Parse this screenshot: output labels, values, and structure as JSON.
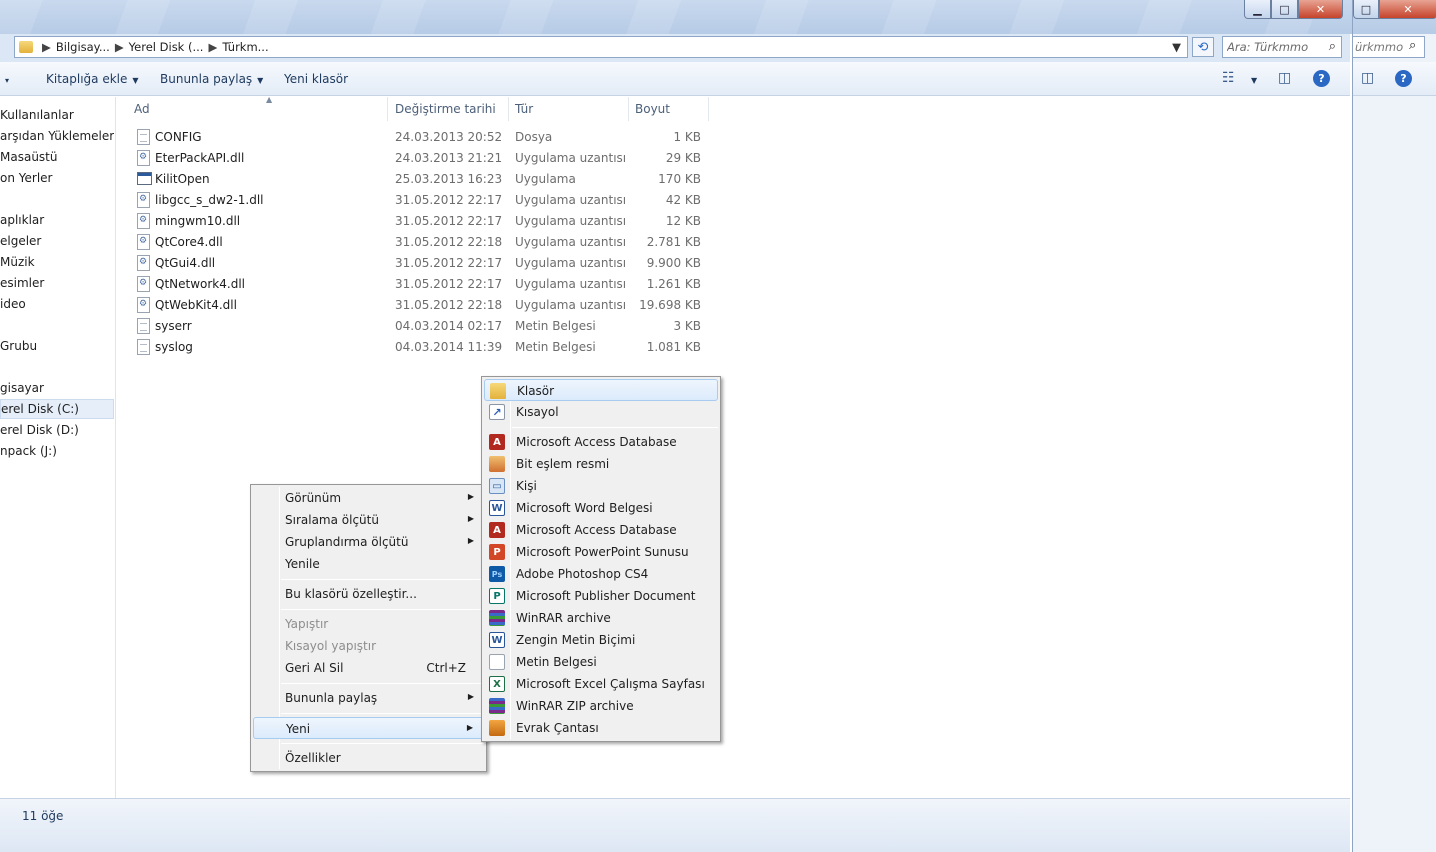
{
  "address": {
    "crumbs": [
      "Bilgisay...",
      "Yerel Disk (...",
      "Türkm..."
    ],
    "search_placeholder": "Ara: Türkmmo",
    "sliver_search": "ürkmmo"
  },
  "toolbar": {
    "organize_arrow": "▾",
    "add_library": "Kitaplığa ekle",
    "share_with": "Bununla paylaş",
    "new_folder": "Yeni klasör"
  },
  "nav": {
    "items": [
      "Kullanılanlar",
      "arşıdan Yüklemeler",
      "Masaüstü",
      "on Yerler",
      "aplıklar",
      "elgeler",
      "Müzik",
      "esimler",
      "ideo",
      "Grubu",
      "gisayar",
      "erel Disk (C:)",
      "erel Disk (D:)",
      "npack (J:)"
    ]
  },
  "columns": [
    "Ad",
    "Değiştirme tarihi",
    "Tür",
    "Boyut"
  ],
  "files": [
    {
      "name": "CONFIG",
      "date": "24.03.2013 20:52",
      "type": "Dosya",
      "size": "1 KB",
      "icon": "txt"
    },
    {
      "name": "EterPackAPI.dll",
      "date": "24.03.2013 21:21",
      "type": "Uygulama uzantısı",
      "size": "29 KB",
      "icon": "dll"
    },
    {
      "name": "KilitOpen",
      "date": "25.03.2013 16:23",
      "type": "Uygulama",
      "size": "170 KB",
      "icon": "exe"
    },
    {
      "name": "libgcc_s_dw2-1.dll",
      "date": "31.05.2012 22:17",
      "type": "Uygulama uzantısı",
      "size": "42 KB",
      "icon": "dll"
    },
    {
      "name": "mingwm10.dll",
      "date": "31.05.2012 22:17",
      "type": "Uygulama uzantısı",
      "size": "12 KB",
      "icon": "dll"
    },
    {
      "name": "QtCore4.dll",
      "date": "31.05.2012 22:18",
      "type": "Uygulama uzantısı",
      "size": "2.781 KB",
      "icon": "dll"
    },
    {
      "name": "QtGui4.dll",
      "date": "31.05.2012 22:17",
      "type": "Uygulama uzantısı",
      "size": "9.900 KB",
      "icon": "dll"
    },
    {
      "name": "QtNetwork4.dll",
      "date": "31.05.2012 22:17",
      "type": "Uygulama uzantısı",
      "size": "1.261 KB",
      "icon": "dll"
    },
    {
      "name": "QtWebKit4.dll",
      "date": "31.05.2012 22:18",
      "type": "Uygulama uzantısı",
      "size": "19.698 KB",
      "icon": "dll"
    },
    {
      "name": "syserr",
      "date": "04.03.2014 02:17",
      "type": "Metin Belgesi",
      "size": "3 KB",
      "icon": "txt"
    },
    {
      "name": "syslog",
      "date": "04.03.2014 11:39",
      "type": "Metin Belgesi",
      "size": "1.081 KB",
      "icon": "txt"
    }
  ],
  "context_menu": {
    "view": "Görünüm",
    "sort_by": "Sıralama ölçütü",
    "group_by": "Gruplandırma ölçütü",
    "refresh": "Yenile",
    "customize": "Bu klasörü özelleştir...",
    "paste": "Yapıştır",
    "paste_shortcut": "Kısayol yapıştır",
    "undo": "Geri Al Sil",
    "undo_shortcut": "Ctrl+Z",
    "share_with": "Bununla paylaş",
    "new": "Yeni",
    "properties": "Özellikler"
  },
  "new_menu": {
    "folder": "Klasör",
    "shortcut": "Kısayol",
    "items": [
      {
        "label": "Microsoft Access Database",
        "icon": "access-icon",
        "glyph": "A"
      },
      {
        "label": "Bit eşlem resmi",
        "icon": "bitmap-icon",
        "glyph": ""
      },
      {
        "label": "Kişi",
        "icon": "contact-icon",
        "glyph": "▭"
      },
      {
        "label": "Microsoft Word Belgesi",
        "icon": "word-icon",
        "glyph": "W"
      },
      {
        "label": "Microsoft Access Database",
        "icon": "access-icon",
        "glyph": "A"
      },
      {
        "label": "Microsoft PowerPoint Sunusu",
        "icon": "powerpoint-icon",
        "glyph": "P"
      },
      {
        "label": "Adobe Photoshop CS4",
        "icon": "photoshop-icon",
        "glyph": "Ps"
      },
      {
        "label": "Microsoft Publisher Document",
        "icon": "publisher-icon",
        "glyph": "P"
      },
      {
        "label": "WinRAR archive",
        "icon": "winrar-icon",
        "glyph": ""
      },
      {
        "label": "Zengin Metin Biçimi",
        "icon": "rtf-icon",
        "glyph": "W"
      },
      {
        "label": "Metin Belgesi",
        "icon": "text-document-icon",
        "glyph": ""
      },
      {
        "label": "Microsoft Excel Çalışma Sayfası",
        "icon": "excel-icon",
        "glyph": "X"
      },
      {
        "label": "WinRAR ZIP archive",
        "icon": "winrar-zip-icon",
        "glyph": ""
      },
      {
        "label": "Evrak Çantası",
        "icon": "briefcase-icon",
        "glyph": ""
      }
    ]
  },
  "status": {
    "count": "11 öğe"
  },
  "window_buttons": {
    "minimize": "▁",
    "maximize": "□",
    "close": "✕"
  }
}
